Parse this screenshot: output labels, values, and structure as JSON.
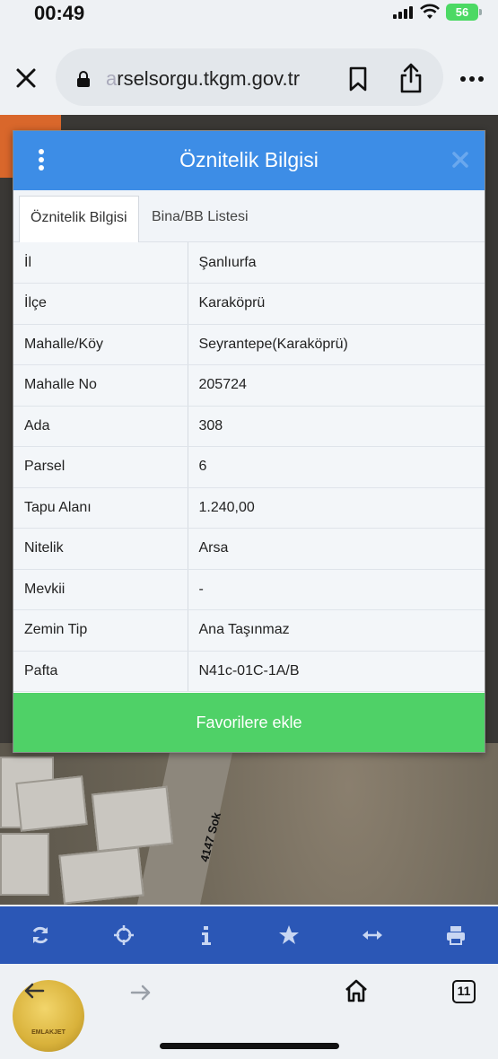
{
  "status_bar": {
    "time": "00:49",
    "battery": "56"
  },
  "browser": {
    "url_faded": "a",
    "url_text": "rselsorgu.tkgm.gov.tr",
    "tab_count": "11"
  },
  "dialog": {
    "title": "Öznitelik Bilgisi",
    "tabs": [
      {
        "label": "Öznitelik Bilgisi"
      },
      {
        "label": "Bina/BB Listesi"
      }
    ],
    "rows": [
      {
        "key": "İl",
        "value": "Şanlıurfa"
      },
      {
        "key": "İlçe",
        "value": "Karaköprü"
      },
      {
        "key": "Mahalle/Köy",
        "value": "Seyrantepe(Karaköprü)"
      },
      {
        "key": "Mahalle No",
        "value": "205724"
      },
      {
        "key": "Ada",
        "value": "308"
      },
      {
        "key": "Parsel",
        "value": "6"
      },
      {
        "key": "Tapu Alanı",
        "value": "1.240,00"
      },
      {
        "key": "Nitelik",
        "value": "Arsa"
      },
      {
        "key": "Mevkii",
        "value": "-"
      },
      {
        "key": "Zemin Tip",
        "value": "Ana Taşınmaz"
      },
      {
        "key": "Pafta",
        "value": "N41c-01C-1A/B"
      }
    ],
    "favorite_button": "Favorilere ekle"
  },
  "map": {
    "road_label": "4147 Sok"
  },
  "logo": {
    "text": "EMLAKJET"
  },
  "colors": {
    "header_blue": "#3d8de6",
    "toolbar_blue": "#2b57b6",
    "favorite_green": "#4fd167"
  },
  "toolbar_icons": [
    "refresh-icon",
    "crosshair-icon",
    "info-icon",
    "star-icon",
    "measure-icon",
    "print-icon"
  ]
}
